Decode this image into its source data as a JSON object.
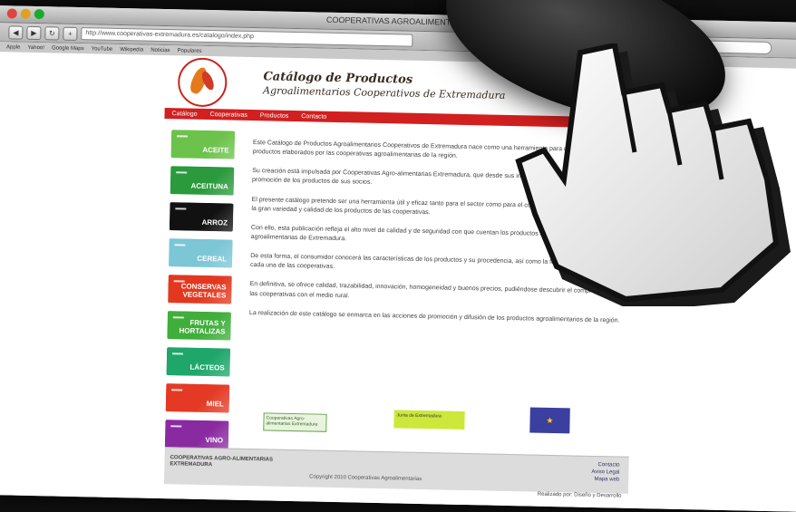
{
  "browser": {
    "window_title": "COOPERATIVAS AGROALIMENTARIAS",
    "url": "http://www.cooperativas-extremadura.es/catalogo/index.php",
    "search_placeholder": "Google",
    "bookmarks": [
      "Apple",
      "Yahoo!",
      "Google Maps",
      "YouTube",
      "Wikipedia",
      "Noticias",
      "Populares"
    ]
  },
  "header": {
    "title": "Catálogo de Productos",
    "subtitle": "Agroalimentarios Cooperativos de Extremadura"
  },
  "nav": [
    "Catálogo",
    "Cooperativas",
    "Productos",
    "Contacto"
  ],
  "categories": [
    {
      "label": "ACEITE",
      "color": "#6cc24a"
    },
    {
      "label": "ACEITUNA",
      "color": "#2a9a3c"
    },
    {
      "label": "ARROZ",
      "color": "#111111"
    },
    {
      "label": "CEREAL",
      "color": "#7cc6d6"
    },
    {
      "label": "CONSERVAS VEGETALES",
      "color": "#e2381f"
    },
    {
      "label": "FRUTAS Y HORTALIZAS",
      "color": "#3fae3a"
    },
    {
      "label": "LÁCTEOS",
      "color": "#1fa66a"
    },
    {
      "label": "MIEL",
      "color": "#e43a25"
    },
    {
      "label": "VINO",
      "color": "#8a2aa0"
    }
  ],
  "content": {
    "paragraphs": [
      "Este Catálogo de Productos Agroalimentarios Cooperativos de Extremadura nace como una herramienta para dar a conocer los productos elaborados por las cooperativas agroalimentarias de la región.",
      "Su creación está impulsada por Cooperativas Agro-alimentarias Extremadura, que desde sus inicios ha apostado por la difusión y promoción de los productos de sus socios.",
      "El presente catálogo pretende ser una herramienta útil y eficaz tanto para el sector como para el consumidor, permitiéndole conocer la gran variedad y calidad de los productos de las cooperativas.",
      "Con ello, esta publicación refleja el alto nivel de calidad y de seguridad con que cuentan los productos de las cooperativas agroalimentarias de Extremadura.",
      "De esta forma, el consumidor conocerá las características de los productos y su procedencia, así como la forma de contactar con cada una de las cooperativas.",
      "En definitiva, se ofrece calidad, trazabilidad, innovación, homogeneidad y buenos precios, pudiéndose descubrir el compromiso de las cooperativas con el medio rural.",
      "La realización de este catálogo se enmarca en las acciones de promoción y difusión de los productos agroalimentarios de la región."
    ]
  },
  "logos": [
    "Cooperativas Agro-alimentarias Extremadura",
    "Junta de Extremadura",
    "Unión Europea"
  ],
  "footer": {
    "logo_text": "COOPERATIVAS AGRO-ALIMENTARIAS EXTREMADURA",
    "copyright": "Copyright 2010 Cooperativas Agroalimentarias",
    "links": [
      "Contacto",
      "Aviso Legal",
      "Mapa web"
    ],
    "credit": "Realizado por: Diseño y Desarrollo"
  }
}
